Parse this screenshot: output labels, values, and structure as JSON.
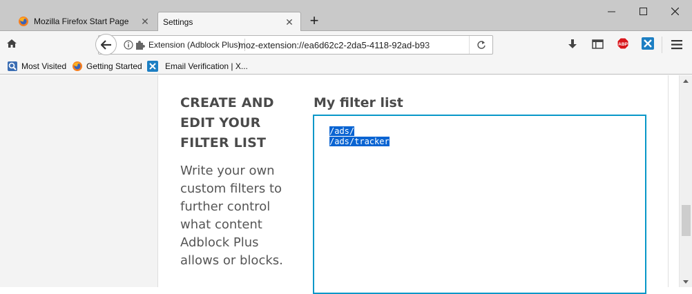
{
  "tabs": [
    {
      "label": "Mozilla Firefox Start Page",
      "active": false
    },
    {
      "label": "Settings",
      "active": true
    }
  ],
  "urlbar": {
    "identity_label": "Extension (Adblock Plus)",
    "url": "moz-extension://ea6d62c2-2da5-4118-92ad-b93"
  },
  "bookmarks": [
    {
      "label": "Most Visited",
      "icon": "most-visited-icon"
    },
    {
      "label": "Getting Started",
      "icon": "firefox-icon"
    },
    {
      "label": "Email Verification | X...",
      "icon": "extension-icon"
    }
  ],
  "section": {
    "heading_lines": [
      "CREATE AND",
      "EDIT YOUR",
      "FILTER LIST"
    ],
    "description": "Write your own custom filters to further control what content Adblock Plus allows or blocks."
  },
  "filter_list": {
    "title": "My filter list",
    "lines": [
      "/ads/",
      "/ads/tracker"
    ]
  },
  "colors": {
    "accent": "#0797c8",
    "selection": "#0a64d2",
    "abp_red": "#d8171c",
    "ext_blue": "#1d7fc3"
  }
}
